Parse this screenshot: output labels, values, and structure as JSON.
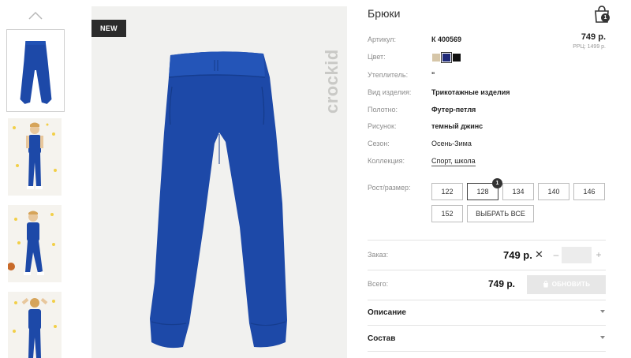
{
  "gallery": {
    "badge": "NEW",
    "brand_watermark": "crockid"
  },
  "product": {
    "title": "Брюки",
    "price_top": "749 р.",
    "rrp": "РРЦ: 1499 р.",
    "cart_count": "1"
  },
  "specs": {
    "article_label": "Артикул:",
    "article_value": "К 400569",
    "color_label": "Цвет:",
    "insulation_label": "Утеплитель:",
    "insulation_value": "\"",
    "type_label": "Вид изделия:",
    "type_value": "Трикотажные изделия",
    "fabric_label": "Полотно:",
    "fabric_value": "Футер-петля",
    "pattern_label": "Рисунок:",
    "pattern_value": "темный джинс",
    "season_label": "Сезон:",
    "season_value": "Осень-Зима",
    "collection_label": "Коллекция:",
    "collection_value": "Спорт, школа"
  },
  "colors": [
    {
      "name": "beige",
      "hex": "#d6c6a8"
    },
    {
      "name": "navy",
      "hex": "#1f2a78",
      "selected": true
    },
    {
      "name": "black",
      "hex": "#111111"
    }
  ],
  "sizes": {
    "label": "Рост/размер:",
    "items": [
      "122",
      "128",
      "134",
      "140",
      "146",
      "152"
    ],
    "selected": "128",
    "selected_count": "1",
    "select_all": "ВЫБРАТЬ ВСЕ"
  },
  "order": {
    "label": "Заказ:",
    "price": "749 р.",
    "multiply": "✕",
    "minus": "–",
    "plus": "+",
    "quantity": ""
  },
  "total": {
    "label": "Всего:",
    "price": "749 р.",
    "update_button": "ОБНОВИТЬ"
  },
  "accordion": {
    "description": "Описание",
    "composition": "Состав"
  },
  "colors_theme": {
    "pants_blue": "#1d49a8",
    "badge_bg": "#2b2b2b"
  }
}
